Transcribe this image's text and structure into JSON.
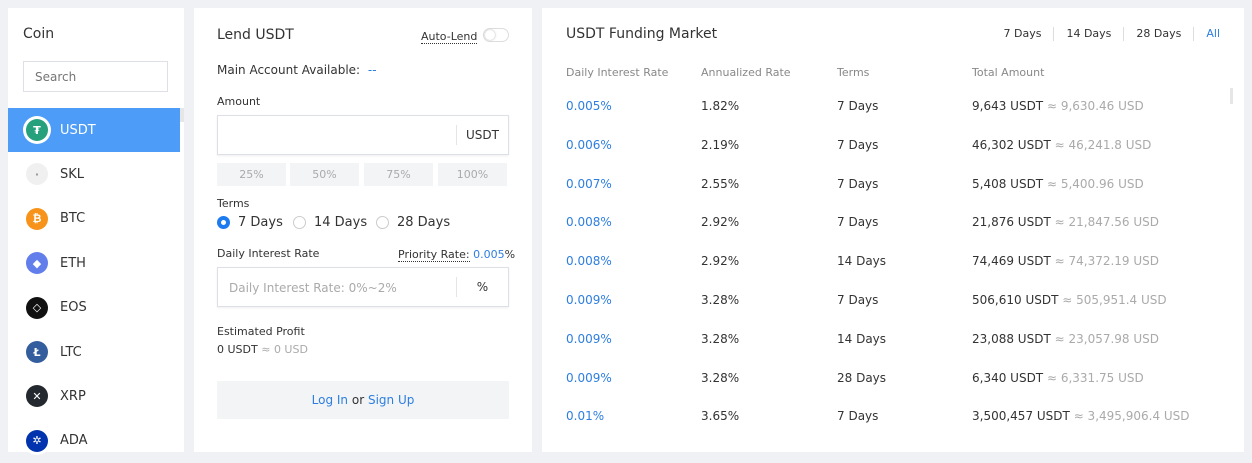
{
  "coins": {
    "title": "Coin",
    "search_placeholder": "Search",
    "items": [
      {
        "name": "USDT",
        "color": "#26a17b",
        "glyph": "₮"
      },
      {
        "name": "SKL",
        "color": "#f0f0f0",
        "glyph": "·"
      },
      {
        "name": "BTC",
        "color": "#f7931a",
        "glyph": "₿"
      },
      {
        "name": "ETH",
        "color": "#627eea",
        "glyph": "◆"
      },
      {
        "name": "EOS",
        "color": "#111111",
        "glyph": "◇"
      },
      {
        "name": "LTC",
        "color": "#345d9d",
        "glyph": "Ł"
      },
      {
        "name": "XRP",
        "color": "#23292f",
        "glyph": "✕"
      },
      {
        "name": "ADA",
        "color": "#0033ad",
        "glyph": "✲"
      }
    ]
  },
  "lend": {
    "title": "Lend USDT",
    "auto_lend": "Auto-Lend",
    "available_label": "Main Account Available:",
    "available_value": "--",
    "amount_label": "Amount",
    "amount_unit": "USDT",
    "percents": [
      "25%",
      "50%",
      "75%",
      "100%"
    ],
    "terms_label": "Terms",
    "terms": [
      "7 Days",
      "14 Days",
      "28 Days"
    ],
    "selected_term": "7 Days",
    "rate_label": "Daily Interest Rate",
    "priority_label": "Priority Rate:",
    "priority_value": "0.005",
    "priority_pct": "%",
    "rate_placeholder": "Daily Interest Rate: 0%~2%",
    "rate_unit": "%",
    "profit_label": "Estimated Profit",
    "profit_usdt": "0 USDT",
    "profit_approx": "≈",
    "profit_usd": "0 USD",
    "login": "Log In",
    "or": " or ",
    "signup": "Sign Up"
  },
  "market": {
    "title": "USDT Funding Market",
    "tabs": [
      "7 Days",
      "14 Days",
      "28 Days",
      "All"
    ],
    "active_tab": "All",
    "headers": [
      "Daily Interest Rate",
      "Annualized Rate",
      "Terms",
      "Total Amount"
    ],
    "rows": [
      {
        "rate": "0.005%",
        "annual": "1.82%",
        "terms": "7 Days",
        "amount": "9,643 USDT",
        "usd": "≈ 9,630.46 USD"
      },
      {
        "rate": "0.006%",
        "annual": "2.19%",
        "terms": "7 Days",
        "amount": "46,302 USDT",
        "usd": "≈ 46,241.8 USD"
      },
      {
        "rate": "0.007%",
        "annual": "2.55%",
        "terms": "7 Days",
        "amount": "5,408 USDT",
        "usd": "≈ 5,400.96 USD"
      },
      {
        "rate": "0.008%",
        "annual": "2.92%",
        "terms": "7 Days",
        "amount": "21,876 USDT",
        "usd": "≈ 21,847.56 USD"
      },
      {
        "rate": "0.008%",
        "annual": "2.92%",
        "terms": "14 Days",
        "amount": "74,469 USDT",
        "usd": "≈ 74,372.19 USD"
      },
      {
        "rate": "0.009%",
        "annual": "3.28%",
        "terms": "7 Days",
        "amount": "506,610 USDT",
        "usd": "≈ 505,951.4 USD"
      },
      {
        "rate": "0.009%",
        "annual": "3.28%",
        "terms": "14 Days",
        "amount": "23,088 USDT",
        "usd": "≈ 23,057.98 USD"
      },
      {
        "rate": "0.009%",
        "annual": "3.28%",
        "terms": "28 Days",
        "amount": "6,340 USDT",
        "usd": "≈ 6,331.75 USD"
      },
      {
        "rate": "0.01%",
        "annual": "3.65%",
        "terms": "7 Days",
        "amount": "3,500,457 USDT",
        "usd": "≈ 3,495,906.4 USD"
      }
    ]
  }
}
